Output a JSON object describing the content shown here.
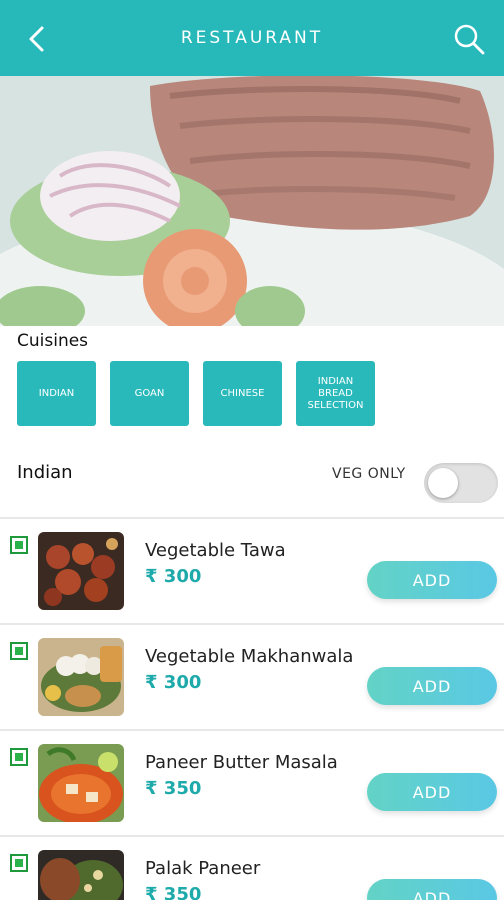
{
  "header": {
    "title": "RESTAURANT",
    "back_icon": "back-arrow-icon",
    "search_icon": "search-icon"
  },
  "cuisines": {
    "label": "Cuisines",
    "chips": [
      "INDIAN",
      "GOAN",
      "CHINESE",
      "INDIAN BREAD SELECTION"
    ]
  },
  "list": {
    "heading": "Indian",
    "veg_only_label": "VEG ONLY",
    "veg_only_on": false
  },
  "dishes": [
    {
      "name": "Vegetable Tawa",
      "price": "₹ 300",
      "add_label": "ADD"
    },
    {
      "name": "Vegetable Makhanwala",
      "price": "₹ 300",
      "add_label": "ADD"
    },
    {
      "name": "Paneer Butter Masala",
      "price": "₹ 350",
      "add_label": "ADD"
    },
    {
      "name": "Palak Paneer",
      "price": "₹ 350",
      "add_label": "ADD"
    }
  ],
  "colors": {
    "primary": "#27b8ba",
    "veg": "#2bb24a",
    "price": "#1eaaab"
  }
}
